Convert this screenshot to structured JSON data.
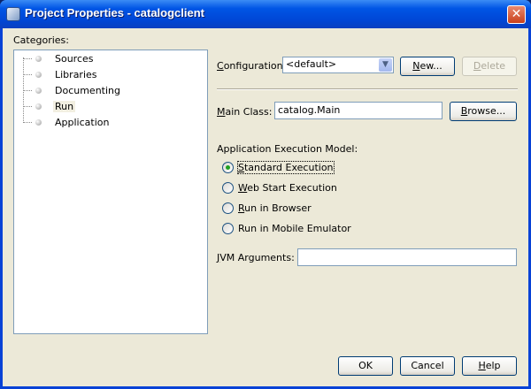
{
  "window": {
    "title": "Project Properties - catalogclient",
    "close": "✕"
  },
  "categories": {
    "label": "Categories:",
    "items": [
      {
        "label": "Sources"
      },
      {
        "label": "Libraries"
      },
      {
        "label": "Documenting"
      },
      {
        "label": "Run",
        "selected": true
      },
      {
        "label": "Application"
      }
    ]
  },
  "config": {
    "label": "Configuration:",
    "value": "<default>",
    "new_label": "New...",
    "delete_label": "Delete"
  },
  "main_class": {
    "label": "Main Class:",
    "value": "catalog.Main",
    "browse_label": "Browse..."
  },
  "exec_model": {
    "label": "Application Execution Model:",
    "options": [
      {
        "label": "Standard Execution",
        "selected": true
      },
      {
        "label": "Web Start Execution"
      },
      {
        "label": "Run in Browser"
      },
      {
        "label": "Run in Mobile Emulator"
      }
    ]
  },
  "jvm": {
    "label": "JVM Arguments:",
    "value": ""
  },
  "footer": {
    "ok": "OK",
    "cancel": "Cancel",
    "help": "Help"
  }
}
